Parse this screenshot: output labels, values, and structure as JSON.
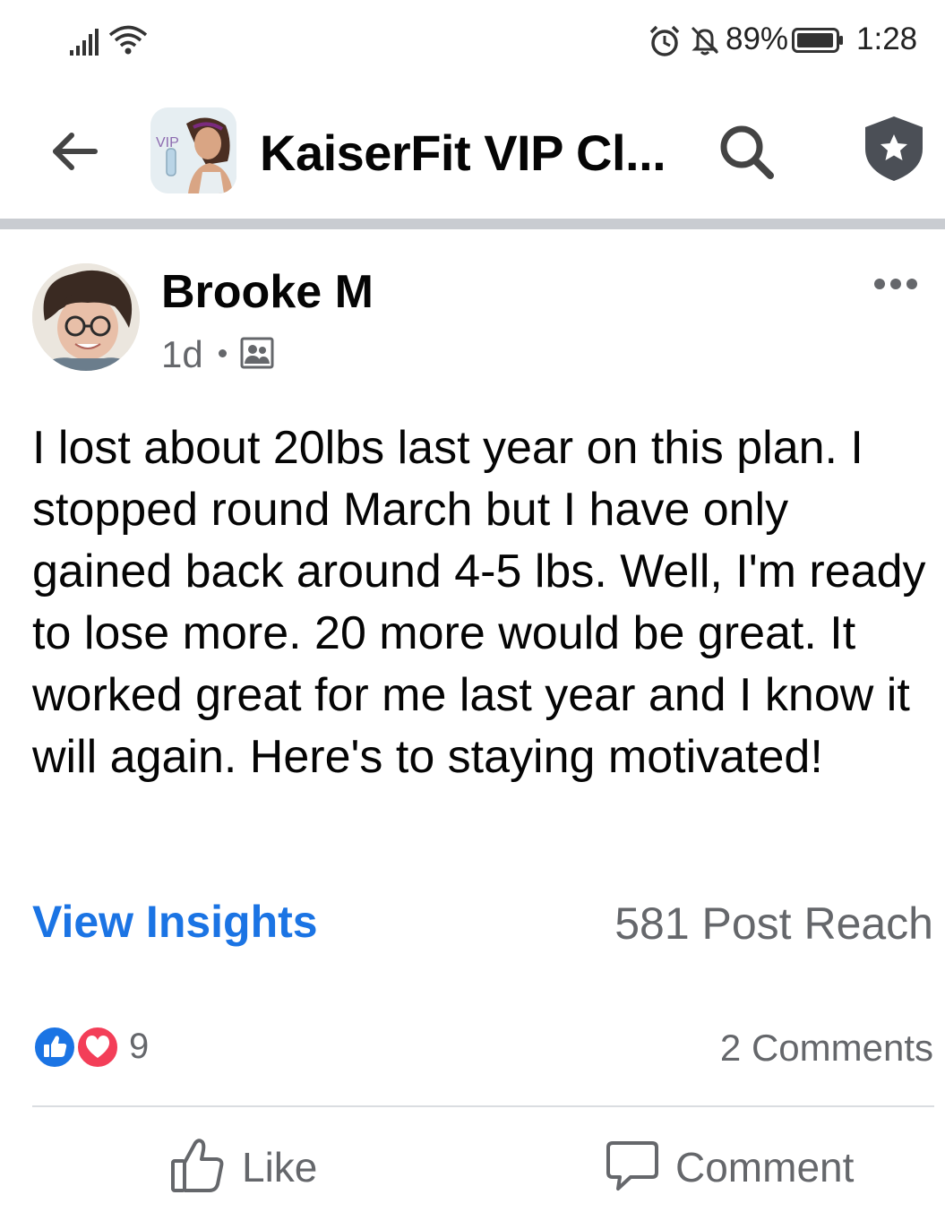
{
  "status_bar": {
    "battery_percent": "89%",
    "time": "1:28",
    "icons": [
      "signal-icon",
      "wifi-icon",
      "alarm-icon",
      "notifications-off-icon",
      "battery-icon"
    ]
  },
  "header": {
    "group_title": "KaiserFit VIP Cl...",
    "group_avatar_text": "VIP",
    "icons": [
      "back-arrow-icon",
      "search-icon",
      "admin-badge-icon"
    ]
  },
  "post": {
    "author": "Brooke M",
    "time": "1d",
    "privacy_icon": "group-members-icon",
    "text": "I lost about 20lbs last year on this plan. I stopped round March but I have only gained back around 4-5 lbs. Well, I'm ready to lose more. 20 more would be great. It worked great for me last year and I know it will again. Here's to staying motivated!"
  },
  "insights": {
    "link_label": "View Insights",
    "reach": "581 Post Reach"
  },
  "reactions": {
    "count": "9",
    "types": [
      "like-icon",
      "love-icon"
    ],
    "comments": "2 Comments"
  },
  "actions": {
    "like_label": "Like",
    "comment_label": "Comment"
  },
  "colors": {
    "link": "#1b74e4",
    "like": "#1b74e4",
    "love": "#f33e58",
    "secondary_text": "#65676b",
    "divider": "#c9ccd1"
  }
}
